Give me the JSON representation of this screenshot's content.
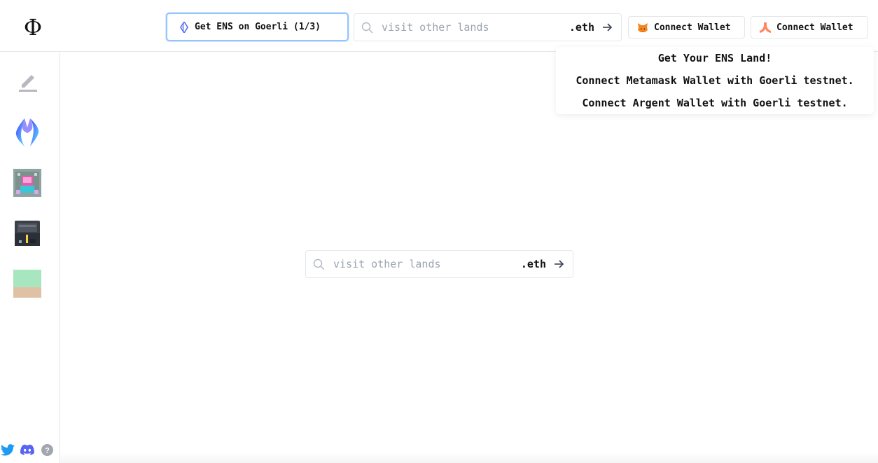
{
  "header": {
    "logo_symbol": "Φ",
    "ens_button_label": "Get ENS on Goerli (1/3)",
    "search": {
      "placeholder": "visit other lands",
      "suffix": ".eth"
    },
    "metamask_button_label": "Connect Wallet",
    "argent_button_label": "Connect Wallet"
  },
  "dropdown": {
    "items": [
      "Get Your ENS Land!",
      "Connect Metamask Wallet with Goerli testnet.",
      "Connect Argent Wallet with Goerli testnet."
    ]
  },
  "main": {
    "search": {
      "placeholder": "visit other lands",
      "suffix": ".eth"
    }
  },
  "sidebar": {
    "items": [
      "edit-icon",
      "ens-logo-icon",
      "castle-icon",
      "shop-icon",
      "land-tile-icon"
    ]
  },
  "footer": {
    "icons": [
      "twitter-icon",
      "discord-icon",
      "help-icon"
    ]
  },
  "colors": {
    "accent_border": "#93c5fd",
    "twitter": "#1d9bf0",
    "discord": "#5865f2",
    "placeholder": "#9ca3af",
    "border": "#e5e7eb"
  }
}
